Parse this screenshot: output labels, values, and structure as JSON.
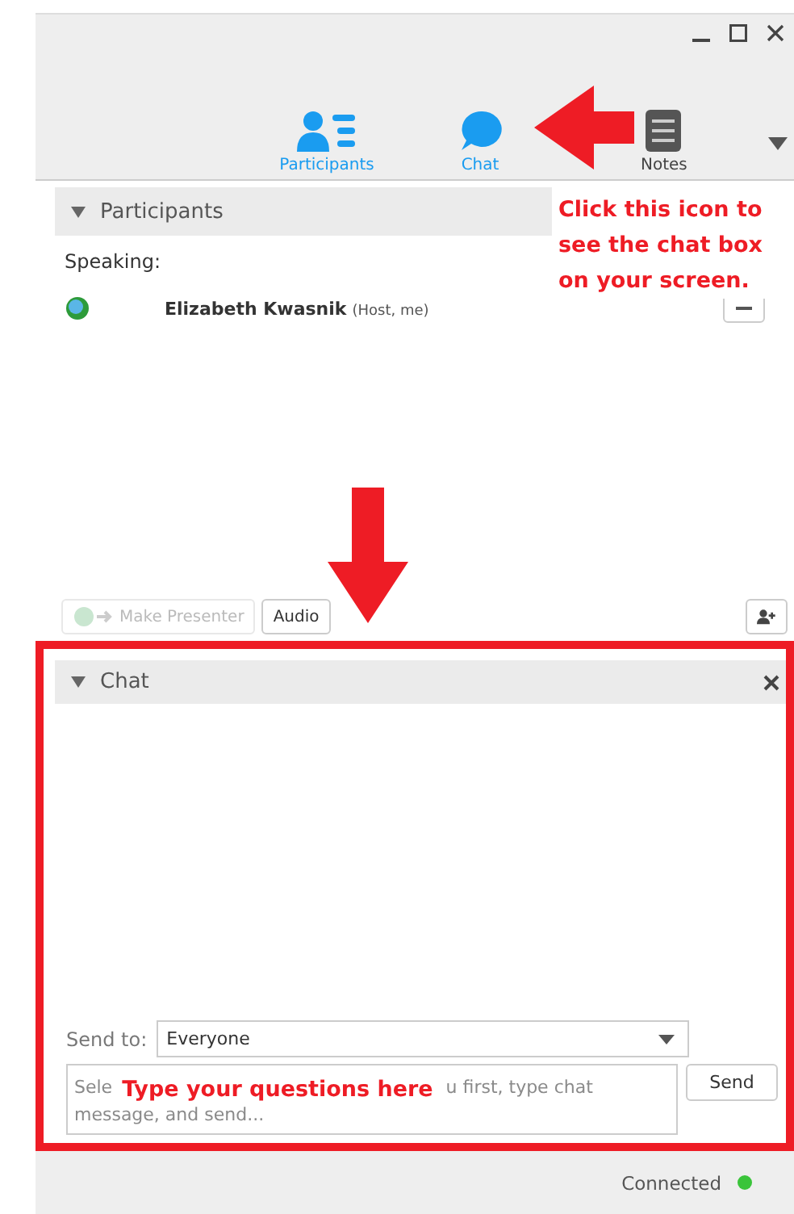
{
  "tabs": [
    {
      "label": "Participants",
      "selected": true,
      "kind": "participants"
    },
    {
      "label": "Chat",
      "selected": true,
      "kind": "chat"
    },
    {
      "label": "Notes",
      "selected": false,
      "kind": "notes"
    }
  ],
  "participants_panel": {
    "title": "Participants",
    "expanded": true,
    "speaking_label": "Speaking:",
    "participants": [
      {
        "name": "Elizabeth Kwasnik",
        "role": "(Host, me)"
      }
    ],
    "buttons": [
      {
        "label": "Make Presenter",
        "disabled": true
      },
      {
        "label": "Audio",
        "disabled": false
      }
    ]
  },
  "chat_panel": {
    "title": "Chat",
    "expanded": true,
    "send_to_label": "Send to:",
    "send_to_value": "Everyone",
    "placeholder_fragments": [
      "Sele",
      "u first, type chat",
      "message, and send..."
    ],
    "send_button": "Send"
  },
  "annotations": [
    {
      "kind": "callout",
      "text": "Click this icon to see the chat box on your screen."
    },
    {
      "kind": "input_note",
      "text": "Type your questions here"
    }
  ],
  "status_bar": {
    "text": "Connected",
    "connected": true
  }
}
